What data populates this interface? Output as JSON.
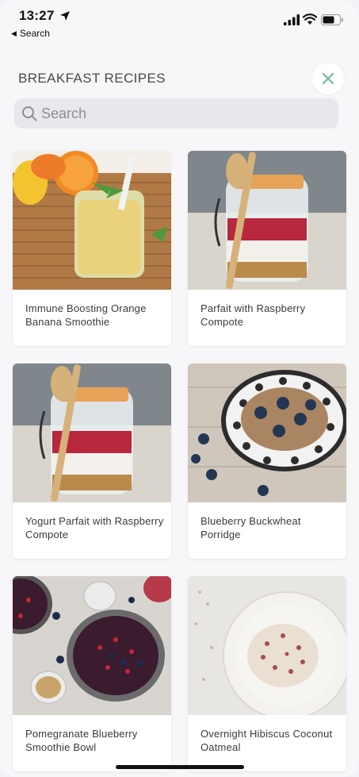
{
  "status": {
    "time": "13:27",
    "back_label": "Search"
  },
  "header": {
    "title": "BREAKFAST RECIPES"
  },
  "search": {
    "placeholder": "Search"
  },
  "recipes": [
    {
      "title": "Immune Boosting Orange Banana Smoothie"
    },
    {
      "title": "Parfait with Raspberry Compote"
    },
    {
      "title": "Yogurt Parfait with Raspberry Compote"
    },
    {
      "title": "Blueberry Buckwheat Porridge"
    },
    {
      "title": "Pomegranate Blueberry Smoothie Bowl"
    },
    {
      "title": "Overnight Hibiscus Coconut Oatmeal"
    }
  ],
  "colors": {
    "accent": "#7fbfa6",
    "background": "#f7f7fa",
    "search_bg": "#e7e7ec"
  }
}
